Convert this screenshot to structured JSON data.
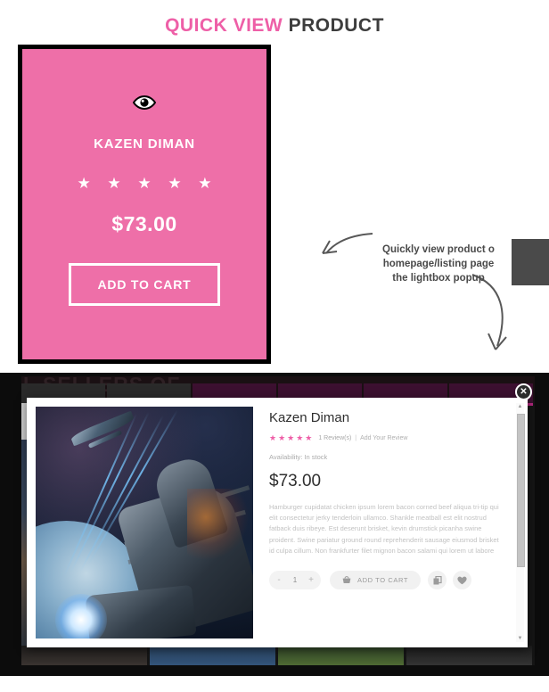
{
  "heading": {
    "part1": "QUICK VIEW",
    "part2": " PRODUCT"
  },
  "card": {
    "quick_view_icon": "eye-icon",
    "name": "KAZEN DIMAN",
    "stars": "★ ★ ★ ★ ★",
    "price": "$73.00",
    "add_to_cart_label": "ADD TO CART",
    "bg_color": "#ee6fa8",
    "text_color": "#ffffff"
  },
  "annotation": {
    "line1": "Quickly view product o",
    "line2": "homepage/listing page",
    "line3": "the lightbox popup"
  },
  "lightbox": {
    "background": {
      "banner_text": "L SELLERS OF"
    },
    "close_label": "✕",
    "product": {
      "image_alt": "space-battleship-scene",
      "title": "Kazen Diman",
      "stars": "★★★★★",
      "review_count": "1 Review(s)",
      "separator": "|",
      "add_review_label": "Add Your Review",
      "availability": "Availability: In stock",
      "price": "$73.00",
      "description": "Hamburger cupidatat chicken ipsum lorem bacon corned beef aliqua tri-tip qui elit consectetur jerky tenderloin ullamco. Shankle meatball est elit nostrud fatback duis ribeye. Est deserunt brisket, kevin drumstick picanha swine proident. Swine pariatur ground round reprehenderit sausage eiusmod brisket id culpa cillum. Non frankfurter filet mignon bacon salami qui lorem ut labore",
      "qty_minus": "-",
      "qty_value": "1",
      "qty_plus": "+",
      "add_to_cart_label": "ADD TO CART",
      "star_color": "#ee5fa7"
    }
  }
}
